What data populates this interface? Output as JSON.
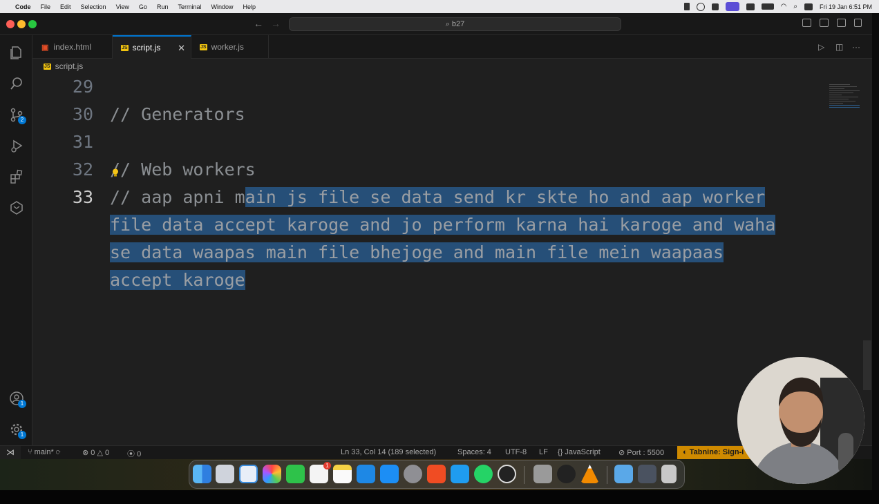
{
  "menubar": {
    "app_name": "Code",
    "items": [
      "File",
      "Edit",
      "Selection",
      "View",
      "Go",
      "Run",
      "Terminal",
      "Window",
      "Help"
    ],
    "clock": "Fri 19 Jan  6:51 PM"
  },
  "titlebar": {
    "search_text": "b27"
  },
  "activity": {
    "source_control_badge": "2",
    "accounts_badge": "1",
    "settings_badge": "1"
  },
  "tabs": [
    {
      "label": "index.html",
      "icon": "html-file-icon"
    },
    {
      "label": "script.js",
      "icon": "js-file-icon",
      "active": true
    },
    {
      "label": "worker.js",
      "icon": "js-file-icon"
    }
  ],
  "breadcrumb": {
    "file": "script.js",
    "icon_label": "JS"
  },
  "editor": {
    "lines": [
      {
        "num": "29",
        "text": ""
      },
      {
        "num": "30",
        "text": "// Generators"
      },
      {
        "num": "31",
        "text": ""
      },
      {
        "num": "32",
        "text": "// Web workers"
      },
      {
        "num": "33",
        "unselected": "// aap apni m",
        "selected": "ain js file se data send kr skte ho and aap worker"
      }
    ],
    "wrapped": [
      "file data accept karoge and jo perform karna hai karoge and waha",
      "se data waapas main file bhejoge and main file mein waapaas",
      "accept karoge"
    ]
  },
  "statusbar": {
    "branch": "main*",
    "errors": "0",
    "warnings": "0",
    "ports": "0",
    "cursor": "Ln 33, Col 14 (189 selected)",
    "spaces": "Spaces: 4",
    "encoding": "UTF-8",
    "eol": "LF",
    "language": "JavaScript",
    "port": "Port : 5500",
    "tabnine": "Tabnine: Sign-i"
  },
  "dock": {
    "notification_badge": "1",
    "apps": [
      "finder-icon",
      "launchpad-icon",
      "safari-icon",
      "photos-icon",
      "facetime-icon",
      "reminders-icon",
      "notes-icon",
      "keynote-icon",
      "app-store-icon",
      "settings-icon",
      "brave-icon",
      "vscode-icon",
      "whatsapp-icon",
      "pen-icon",
      "dictionary-icon",
      "obs-icon",
      "vlc-icon",
      "folder-icon",
      "screenshot-icon",
      "trash-icon"
    ]
  },
  "colors": {
    "selection": "#264f78",
    "accent": "#0078d4",
    "tabnine": "#cf8a00"
  }
}
